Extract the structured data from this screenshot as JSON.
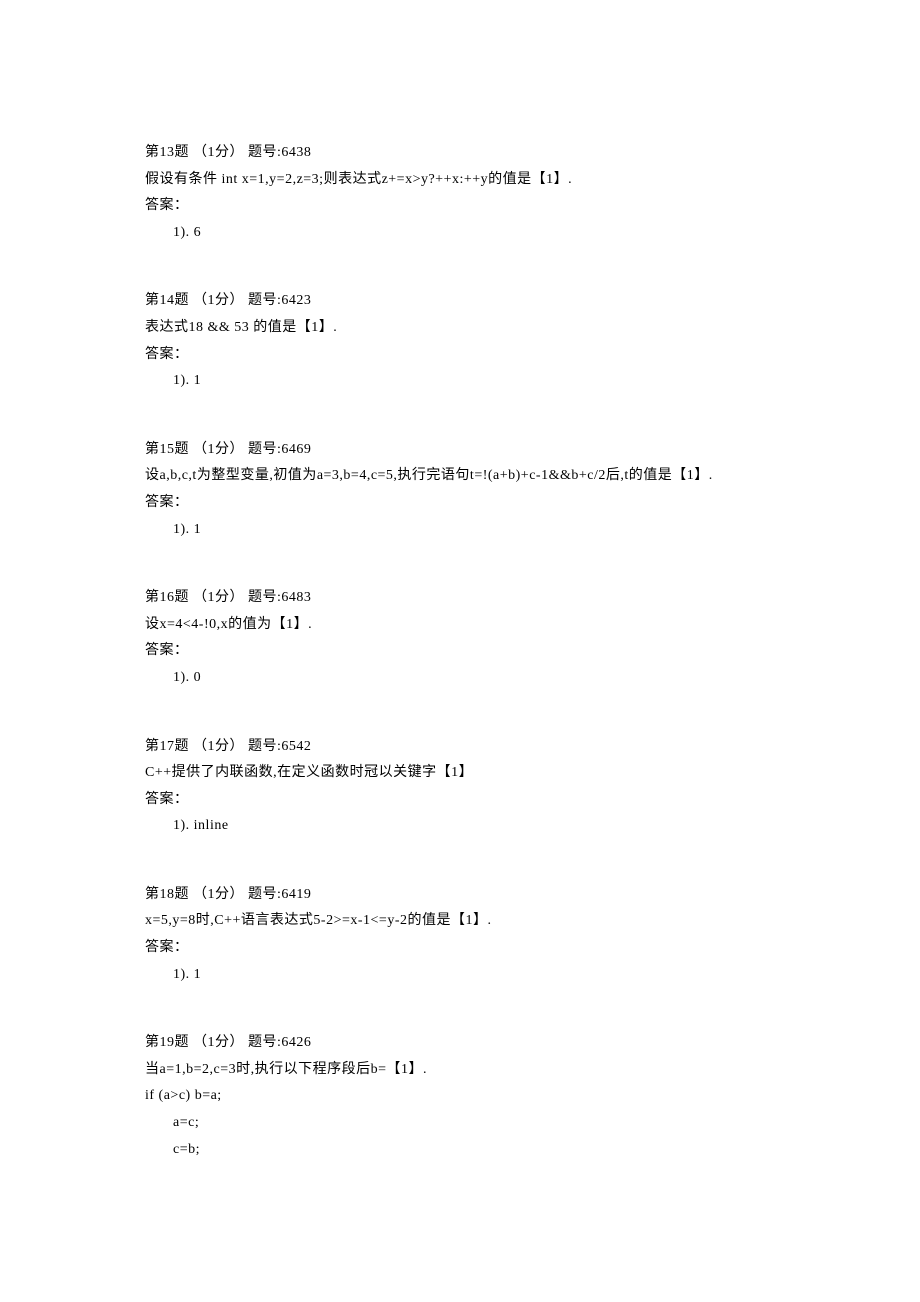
{
  "questions": [
    {
      "header": "第13题 （1分）  题号:6438",
      "prompt": "假设有条件 int x=1,y=2,z=3;则表达式z+=x>y?++x:++y的值是【1】.",
      "answer_label": "答案：",
      "answer_item": "1). 6"
    },
    {
      "header": "第14题 （1分）  题号:6423",
      "prompt": "表达式18 && 53 的值是【1】.",
      "answer_label": "答案：",
      "answer_item": "1). 1"
    },
    {
      "header": "第15题 （1分）  题号:6469",
      "prompt": "设a,b,c,t为整型变量,初值为a=3,b=4,c=5,执行完语句t=!(a+b)+c-1&&b+c/2后,t的值是【1】.",
      "answer_label": "答案：",
      "answer_item": "1). 1"
    },
    {
      "header": "第16题 （1分）  题号:6483",
      "prompt": "设x=4<4-!0,x的值为【1】.",
      "answer_label": "答案：",
      "answer_item": "1). 0"
    },
    {
      "header": "第17题 （1分）  题号:6542",
      "prompt": "C++提供了内联函数,在定义函数时冠以关键字【1】",
      "answer_label": "答案：",
      "answer_item": "1). inline"
    },
    {
      "header": "第18题 （1分）  题号:6419",
      "prompt": "x=5,y=8时,C++语言表达式5-2>=x-1<=y-2的值是【1】.",
      "answer_label": "答案：",
      "answer_item": "1). 1"
    }
  ],
  "q19": {
    "header": "第19题 （1分）  题号:6426",
    "prompt": "当a=1,b=2,c=3时,执行以下程序段后b=【1】.",
    "code_lines": [
      "if (a>c)  b=a;",
      "a=c;",
      "c=b;"
    ]
  }
}
